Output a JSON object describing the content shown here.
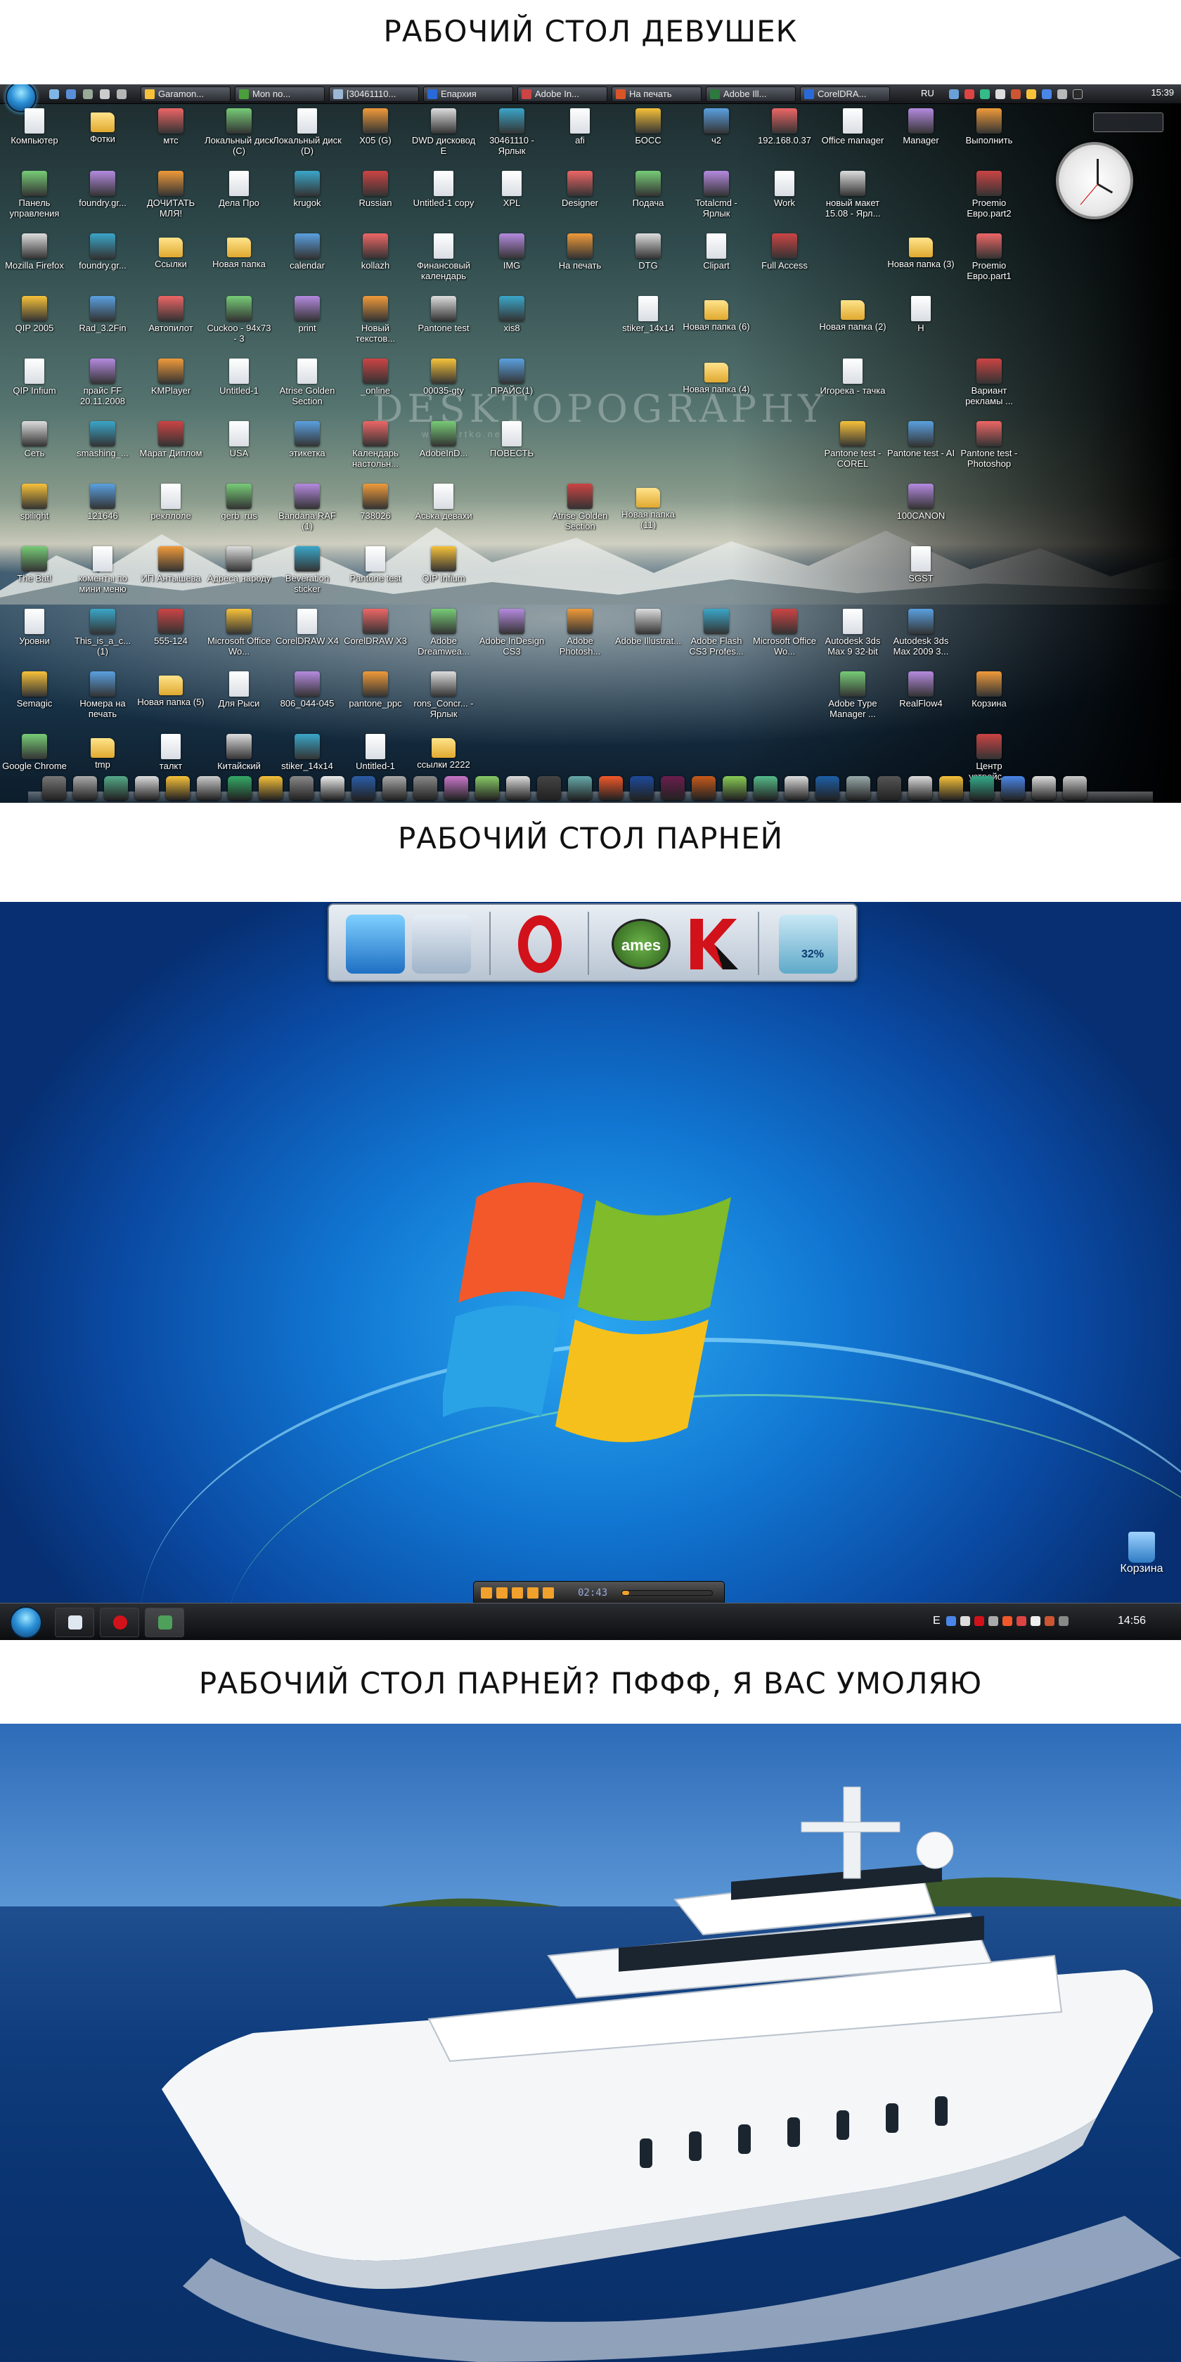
{
  "captions": {
    "girls": "РАБОЧИЙ СТОЛ ДЕВУШЕК",
    "guys": "РАБОЧИЙ СТОЛ ПАРНЕЙ",
    "yacht": "РАБОЧИЙ СТОЛ ПАРНЕЙ? ПФФФ, Я ВАС УМОЛЯЮ"
  },
  "girls_desktop": {
    "taskbar_items": [
      "Garamon...",
      "Mon no...",
      "[30461110...",
      "Епархия",
      "Adobe In...",
      "На печать",
      "Adobe Ill...",
      "CorelDRA..."
    ],
    "lang": "RU",
    "clock": "15:39",
    "watermark": "DESKTOPOGRAPHY",
    "watermark_sub": "www.artko.net",
    "icons": [
      [
        "Компьютер",
        "Фотки",
        "мтс",
        "Локальный диск (C)",
        "Локальный диск (D)",
        "X05 (G)",
        "DWD дисковод E",
        "30461110 - Ярлык",
        "afi",
        "БОСС",
        "ч2",
        "192.168.0.37",
        "Office manager",
        "Manager",
        "Выполнить"
      ],
      [
        "Панель управления",
        "foundry.gr...",
        "ДОЧИТАТЬ МЛЯ!",
        "Дела Про",
        "krugok",
        "Russian",
        "Untitled-1 copy",
        "XPL",
        "Designer",
        "Подача",
        "Totalcmd - Ярлык",
        "Work",
        "новый макет 15.08 - Ярл...",
        "",
        "Proemio Евро.part2"
      ],
      [
        "Mozilla Firefox",
        "foundry.gr...",
        "Ссылки",
        "Новая папка",
        "calendar",
        "kollazh",
        "Финансовый календарь",
        "IMG",
        "На печать",
        "DTG",
        "Clipart",
        "Full Access",
        "",
        "Новая папка (3)",
        "Proemio Евро.part1"
      ],
      [
        "QIP 2005",
        "Rad_3.2Fin",
        "Автопилот",
        "Cuckoo - 94x73 - 3",
        "print",
        "Новый текстов...",
        "Pantone test",
        "xis8",
        "",
        "stiker_14x14",
        "Новая папка (6)",
        "",
        "Новая папка (2)",
        "H",
        ""
      ],
      [
        "QIP Infium",
        "прайс FF 20.11.2008",
        "KMPlayer",
        "Untitled-1",
        "Atrise Golden Section",
        "_online",
        "00035-gty",
        "ПРАЙС(1)",
        "",
        "",
        "Новая папка (4)",
        "",
        "Игорека - тачка",
        "",
        "Вариант рекламы ..."
      ],
      [
        "Сеть",
        "smashing_...",
        "Марат Диплом",
        "USA",
        "этикетка",
        "Календарь настольн...",
        "AdobeInD...",
        "ПОВЕСТЬ",
        "",
        "",
        "",
        "",
        "Pantone test - COREL",
        "Pantone test - AI",
        "Pantone test - Photoshop"
      ],
      [
        "spilight",
        "121646",
        "рекллоле",
        "gerb_rus",
        "Bandana RAF (1)",
        "738026",
        "Аська девахи",
        "",
        "Atrise Golden Section",
        "Новая папка (11)",
        "",
        "",
        "",
        "100CANON",
        ""
      ],
      [
        "The Bat!",
        "коменты по мини меню",
        "ИП Антышева",
        "Адреса народу",
        "Beveration sticker",
        "Pantone test",
        "QIP Infium",
        "",
        "",
        "",
        "",
        "",
        "",
        "SGST",
        ""
      ],
      [
        "Уровни",
        "This_is_a_c... (1)",
        "555-124",
        "Microsoft Office Wo...",
        "CorelDRAW X4",
        "CorelDRAW X3",
        "Adobe Dreamwea...",
        "Adobe InDesign CS3",
        "Adobe Photosh...",
        "Adobe Illustrat...",
        "Adobe Flash CS3 Profes...",
        "Microsoft Office Wo...",
        "Autodesk 3ds Max 9 32-bit",
        "Autodesk 3ds Max 2009 3...",
        ""
      ],
      [
        "Semagic",
        "Номера на печать",
        "Новая папка (5)",
        "Для Рыси",
        "806_044-045",
        "pantone_ppc",
        "rons_Concr... - Ярлык",
        "",
        "",
        "",
        "",
        "",
        "Adobe Type Manager ...",
        "RealFlow4",
        "Корзина"
      ],
      [
        "Google Chrome",
        "tmp",
        "талкт",
        "Китайский",
        "stiker_14x14",
        "Untitled-1",
        "ссылки 2222",
        "",
        "",
        "",
        "",
        "",
        "",
        "",
        "Центр устройс..."
      ]
    ]
  },
  "guys_desktop": {
    "dock_battery": "32%",
    "dock_games": "ames",
    "player_time": "02:43",
    "recycle_bin": "Корзина",
    "lang": "E",
    "clock": "14:56"
  },
  "colors": {
    "win7_blue": "#1177d2",
    "ms_red": "#f2582a",
    "ms_green": "#7fbb2a",
    "ms_blue": "#29a3e6",
    "ms_yellow": "#f6c01c"
  }
}
